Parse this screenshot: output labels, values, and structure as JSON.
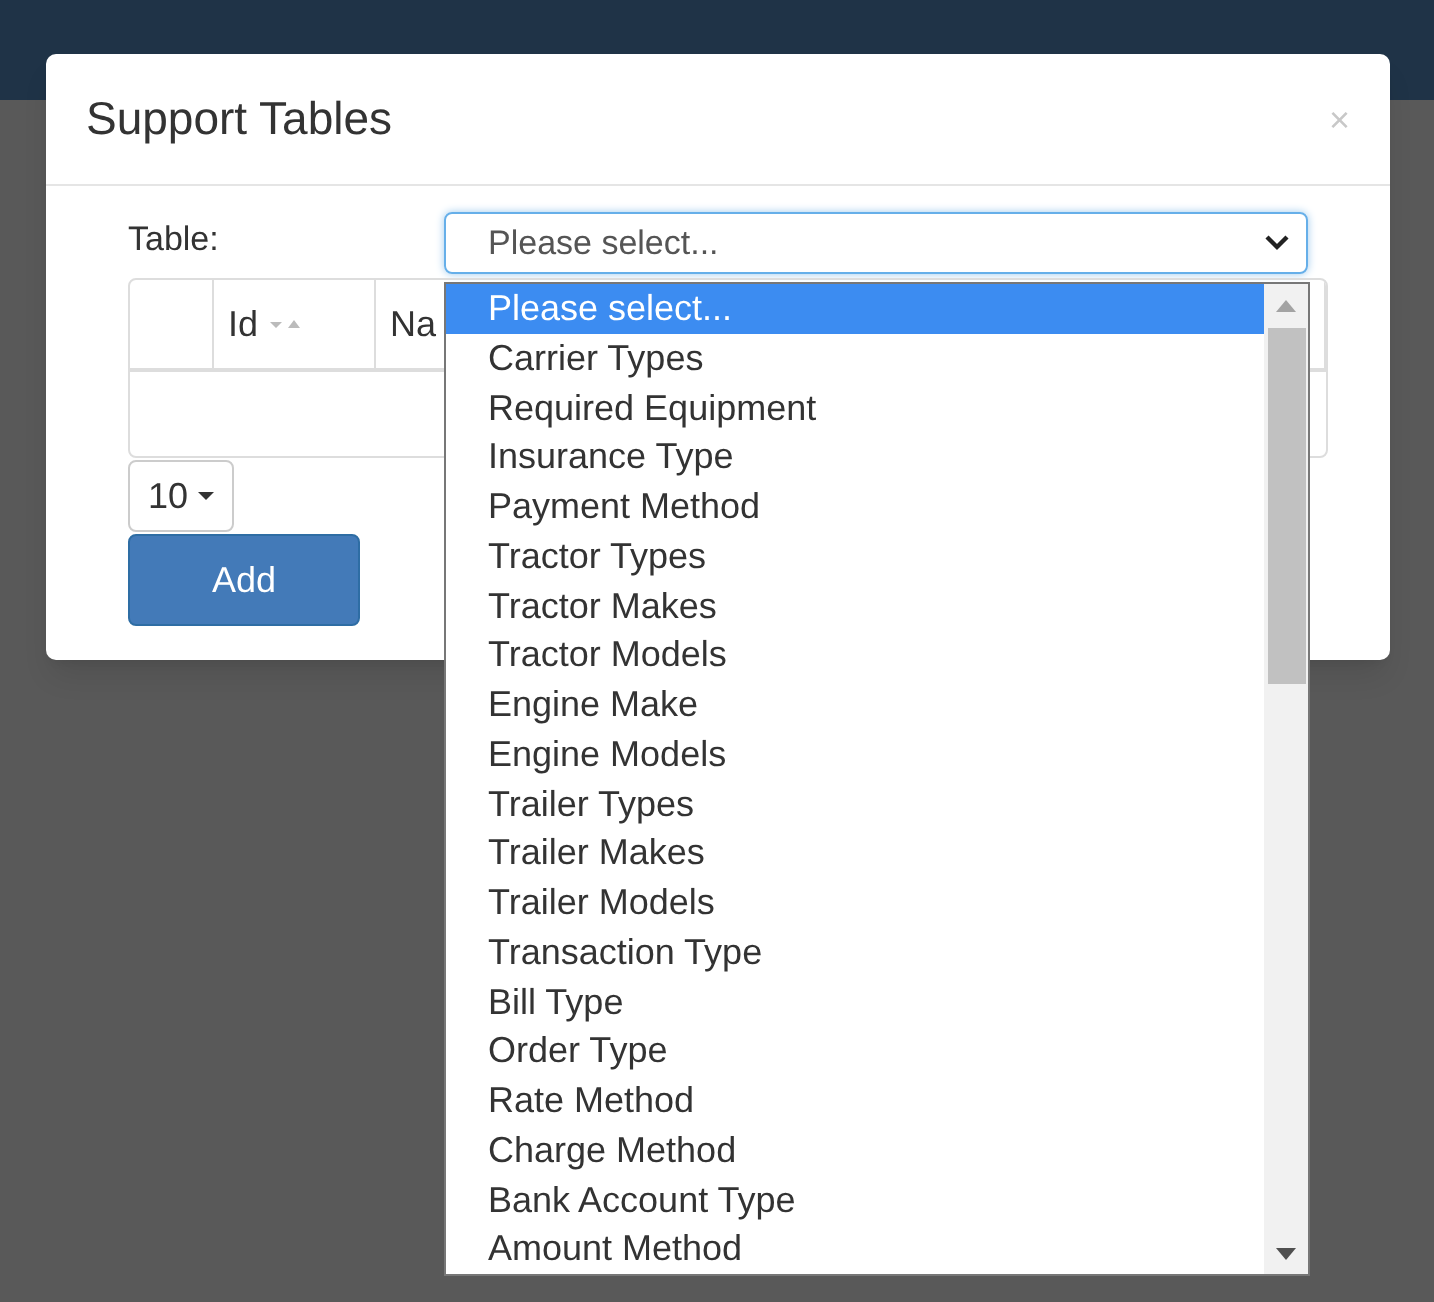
{
  "dialog": {
    "title": "Support Tables",
    "close": "×"
  },
  "table_field": {
    "label": "Table:",
    "value": "Please select...",
    "expanded": true
  },
  "grid": {
    "columns": [
      "",
      "Id",
      "Na"
    ]
  },
  "page_size": {
    "value": "10"
  },
  "add_button": "Add",
  "options": [
    {
      "label": "Please select...",
      "selected": true
    },
    {
      "label": "Carrier Types",
      "selected": false
    },
    {
      "label": "Required Equipment",
      "selected": false
    },
    {
      "label": "Insurance Type",
      "selected": false
    },
    {
      "label": "Payment Method",
      "selected": false
    },
    {
      "label": "Tractor Types",
      "selected": false
    },
    {
      "label": "Tractor Makes",
      "selected": false
    },
    {
      "label": "Tractor Models",
      "selected": false
    },
    {
      "label": "Engine Make",
      "selected": false
    },
    {
      "label": "Engine Models",
      "selected": false
    },
    {
      "label": "Trailer Types",
      "selected": false
    },
    {
      "label": "Trailer Makes",
      "selected": false
    },
    {
      "label": "Trailer Models",
      "selected": false
    },
    {
      "label": "Transaction Type",
      "selected": false
    },
    {
      "label": "Bill Type",
      "selected": false
    },
    {
      "label": "Order Type",
      "selected": false
    },
    {
      "label": "Rate Method",
      "selected": false
    },
    {
      "label": "Charge Method",
      "selected": false
    },
    {
      "label": "Bank Account Type",
      "selected": false
    },
    {
      "label": "Amount Method",
      "selected": false
    }
  ]
}
